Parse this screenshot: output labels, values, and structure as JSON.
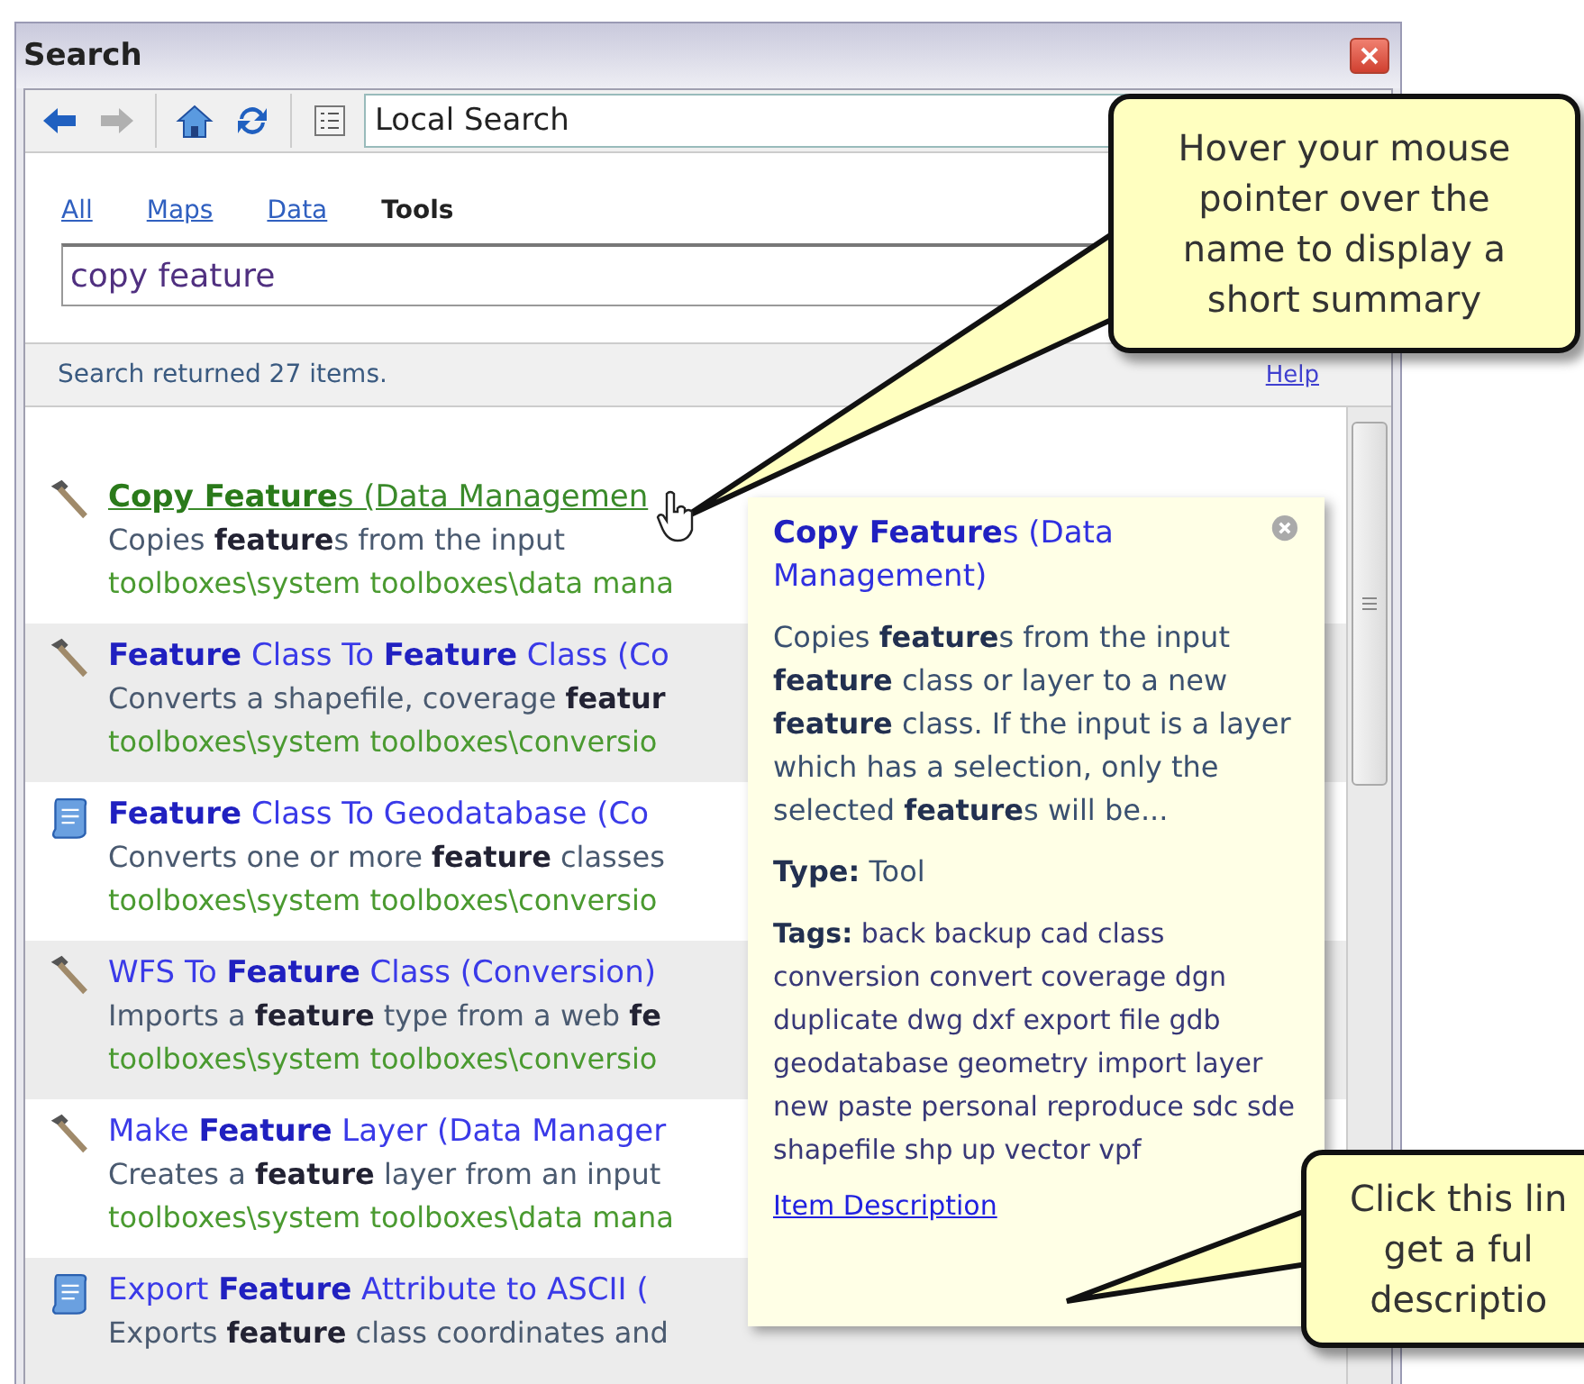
{
  "window": {
    "title": "Search"
  },
  "toolbar": {
    "buttons": [
      {
        "kind": "back",
        "disabled": false
      },
      {
        "kind": "forward",
        "disabled": true
      },
      {
        "kind": "home",
        "disabled": false
      },
      {
        "kind": "refresh",
        "disabled": false
      },
      {
        "kind": "list",
        "disabled": false
      }
    ],
    "location": "Local Search"
  },
  "tabs": [
    {
      "label": "All",
      "selected": false
    },
    {
      "label": "Maps",
      "selected": false
    },
    {
      "label": "Data",
      "selected": false
    },
    {
      "label": "Tools",
      "selected": true
    }
  ],
  "search": {
    "value": "copy feature"
  },
  "status": {
    "text": "Search returned 27 items.",
    "help": "Help"
  },
  "results": [
    {
      "kind": "hammer",
      "hovered": true,
      "title": "**Copy Feature**s (Data Managemen",
      "summary": "Copies **feature**s from the input",
      "path": "toolboxes\\system toolboxes\\data mana"
    },
    {
      "kind": "hammer",
      "hovered": false,
      "title": "**Feature** Class To **Feature** Class (Co",
      "summary": "Converts a shapefile, coverage **featur**",
      "path": "toolboxes\\system toolboxes\\conversio"
    },
    {
      "kind": "script",
      "hovered": false,
      "title": "**Feature** Class To Geodatabase (Co",
      "summary": "Converts one or more **feature** classes",
      "path": "toolboxes\\system toolboxes\\conversio"
    },
    {
      "kind": "hammer",
      "hovered": false,
      "title": "WFS To **Feature** Class (Conversion)",
      "summary": "Imports a **feature** type from a web **fe**",
      "path": "toolboxes\\system toolboxes\\conversio"
    },
    {
      "kind": "hammer",
      "hovered": false,
      "title": "Make **Feature** Layer (Data Manager",
      "summary": "Creates a **feature** layer from an input",
      "path": "toolboxes\\system toolboxes\\data mana"
    },
    {
      "kind": "script",
      "hovered": false,
      "title": "Export **Feature** Attribute to ASCII (",
      "summary": "Exports **feature** class coordinates and"
    }
  ],
  "tooltip": {
    "title": "**Copy Feature**s (Data Management)",
    "summary": "Copies **feature**s from the input **feature** class or layer to a new **feature** class. If the input is a layer which has a selection, only the selected **feature**s will be...",
    "type": "**Type:** Tool",
    "tags": "**Tags:** back backup cad class conversion convert coverage dgn duplicate dwg dxf export file gdb geodatabase geometry import layer new paste personal reproduce sdc sde shapefile shp up vector vpf",
    "link": "Item Description"
  },
  "callouts": [
    {
      "lines": [
        "Hover your mouse",
        "pointer over the",
        "name to display a",
        "short summary"
      ]
    },
    {
      "lines": [
        "Click this lin",
        "get a ful",
        "descriptio"
      ]
    }
  ]
}
